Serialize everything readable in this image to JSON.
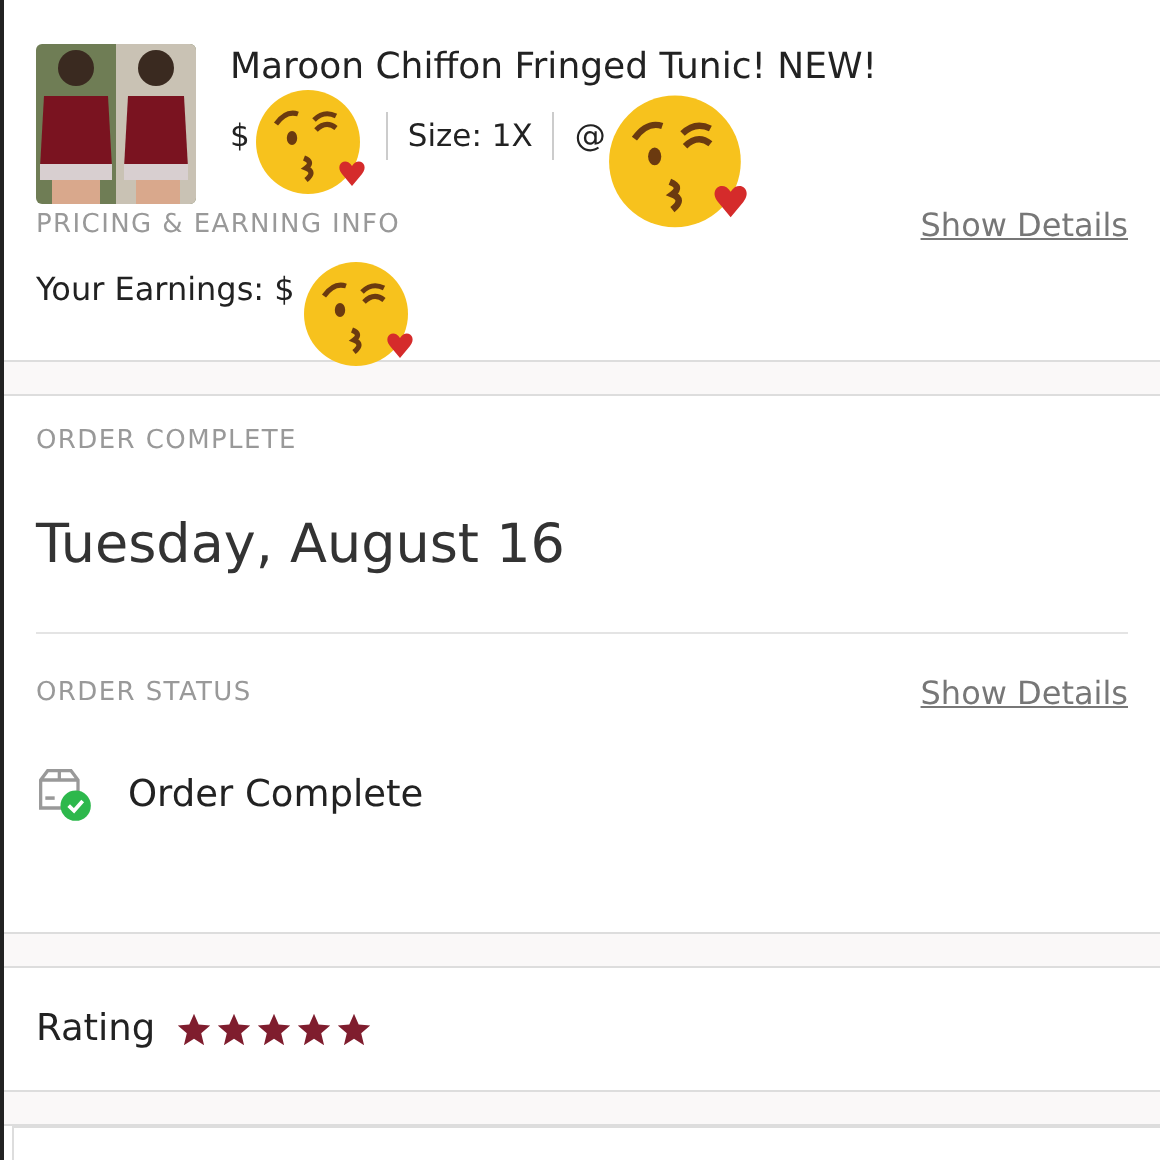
{
  "listing": {
    "kind": "picture",
    "title": "Maroon Chiffon Fringed Tunic! NEW!",
    "price": "$",
    "size": "Size: 1X",
    "seller": "@"
  },
  "pricing": {
    "heading": "PRICING & EARNING INFO",
    "link": "Show Details",
    "earnings": "Your Earnings: $"
  },
  "order": {
    "heading": "ORDER COMPLETE",
    "date": "Tuesday, August 16"
  },
  "status": {
    "heading": "ORDER STATUS",
    "link": "Show Details",
    "text": "Order Complete",
    "complete": true
  },
  "rating": {
    "label": "Rating",
    "stars": 5
  }
}
